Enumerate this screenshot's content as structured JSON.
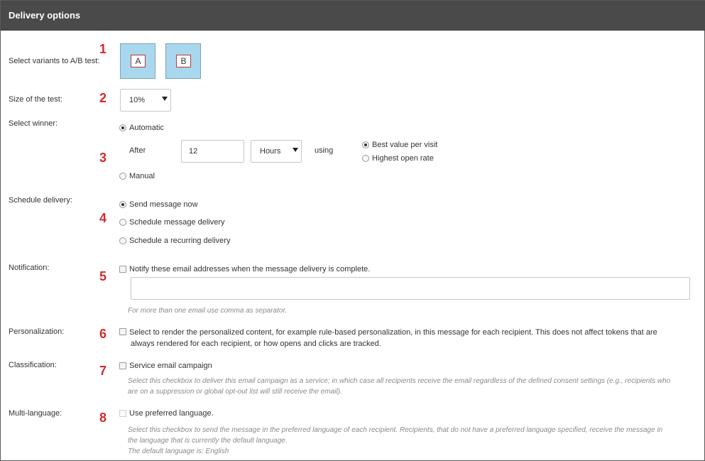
{
  "header": {
    "title": "Delivery options"
  },
  "rows": {
    "variants": {
      "label": "Select variants to A/B test:",
      "number": "1",
      "variant_a": "A",
      "variant_b": "B"
    },
    "size": {
      "label": "Size of the test:",
      "number": "2",
      "value": "10%"
    },
    "winner": {
      "label": "Select winner:",
      "number": "3",
      "automatic": "Automatic",
      "after": "After",
      "after_value": "12",
      "unit": "Hours",
      "using": "using",
      "best_value": "Best value per visit",
      "highest_open": "Highest open rate",
      "manual": "Manual"
    },
    "schedule": {
      "label": "Schedule delivery:",
      "number": "4",
      "send_now": "Send message now",
      "schedule_message": "Schedule message delivery",
      "schedule_recurring": "Schedule a recurring delivery"
    },
    "notification": {
      "label": "Notification:",
      "number": "5",
      "checkbox": "Notify these email addresses when the message delivery is complete.",
      "email_value": "",
      "hint": "For more than one email use comma as separator."
    },
    "personalization": {
      "label": "Personalization:",
      "number": "6",
      "line1": "Select to render the personalized content, for example rule-based personalization, in this message for each recipient. This does not affect tokens that are",
      "line2": "always rendered for each recipient, or how opens and clicks are tracked."
    },
    "classification": {
      "label": "Classification:",
      "number": "7",
      "checkbox": "Service email campaign",
      "hint1": "Select this checkbox to deliver this email campaign as a service; in which case all recipients receive the email regardless of the defined consent settings (e.g., recipients who",
      "hint2": "are on a suppression or global opt-out list will still receive the email)."
    },
    "multilang": {
      "label": "Multi-language:",
      "number": "8",
      "checkbox": "Use preferred language.",
      "hint1": "Select this checkbox to send the message in the preferred language of each recipient. Recipients, that do not have a preferred language specified, receive the message in",
      "hint2": "the language that is currently the default language.",
      "hint3": "The default language is: English"
    }
  }
}
